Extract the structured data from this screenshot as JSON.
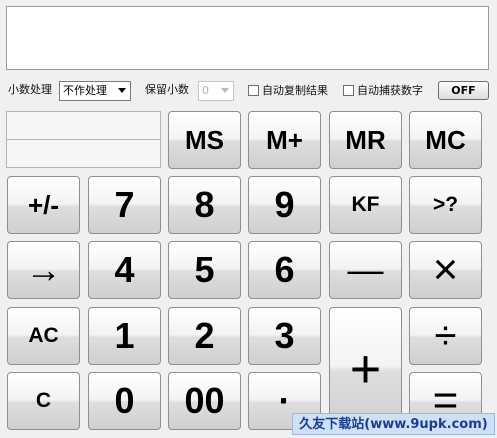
{
  "display": {
    "value": ""
  },
  "options": {
    "decimal_label": "小数处理",
    "decimal_select": "不作处理",
    "keep_label": "保留小数",
    "keep_select": "0",
    "auto_copy": "自动复制结果",
    "auto_capture": "自动捕获数字",
    "off_button": "OFF"
  },
  "keys": {
    "ms": "MS",
    "mplus": "M+",
    "mr": "MR",
    "mc": "MC",
    "sign": "+/-",
    "d7": "7",
    "d8": "8",
    "d9": "9",
    "kf": "KF",
    "query": ">?",
    "arrow": "→",
    "d4": "4",
    "d5": "5",
    "d6": "6",
    "minus": "—",
    "times": "×",
    "ac": "AC",
    "d1": "1",
    "d2": "2",
    "d3": "3",
    "plus": "+",
    "divide": "÷",
    "c": "C",
    "d0": "0",
    "d00": "00",
    "dot": "·",
    "equals": "="
  },
  "watermark": "久友下载站(www.9upk.com)"
}
